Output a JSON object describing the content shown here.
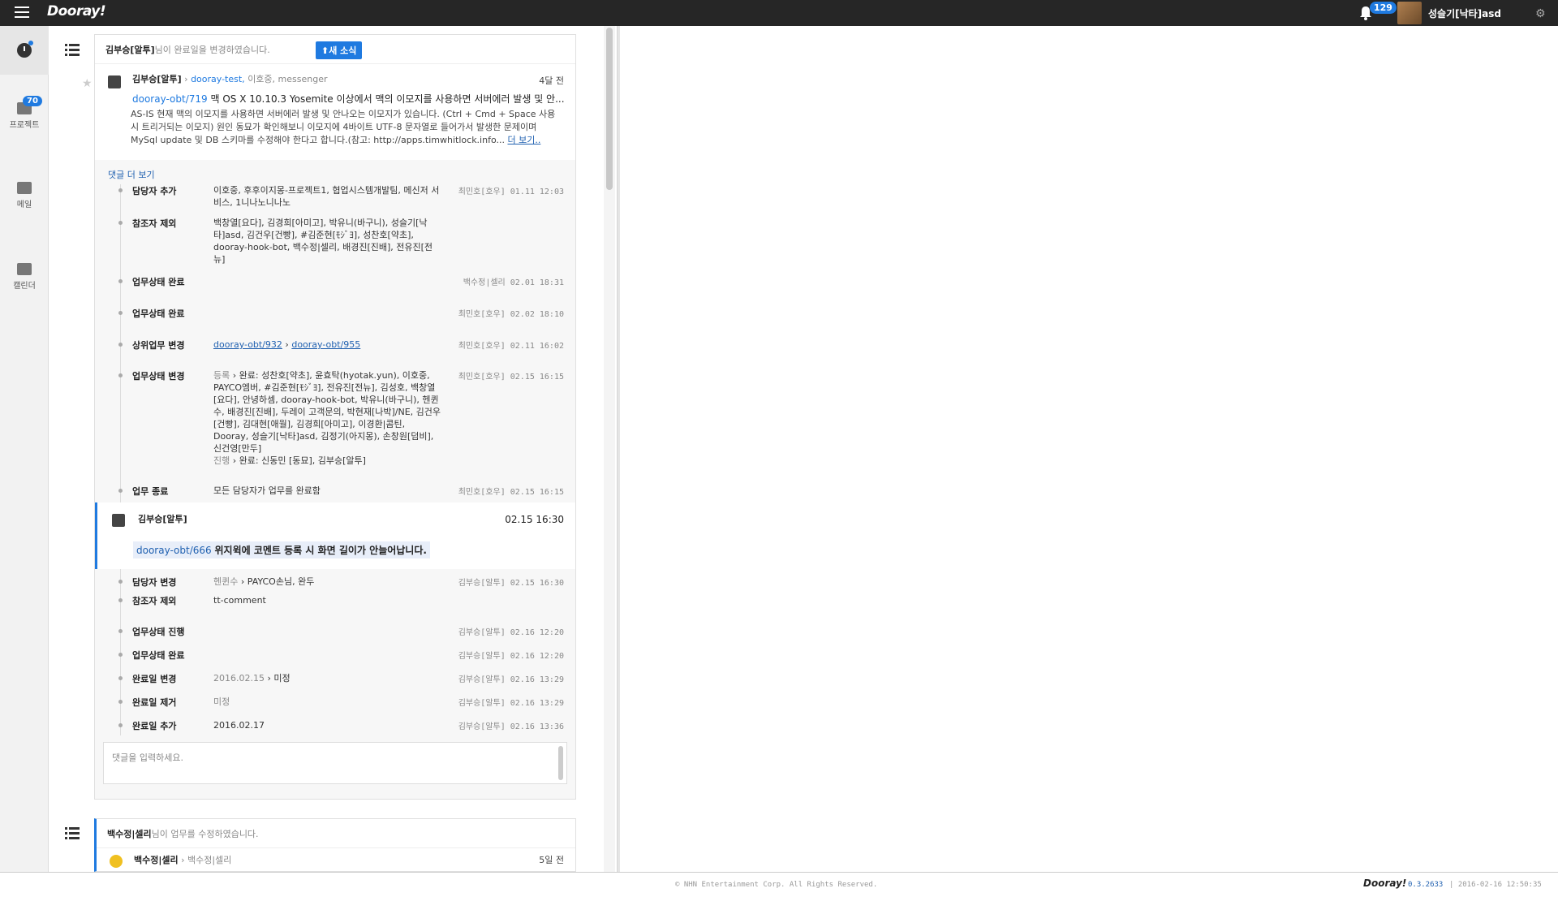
{
  "topbar": {
    "logo": "Dooray!",
    "notification_count": "129",
    "user_name": "성슬기[낙타]asd"
  },
  "lnb": [
    {
      "label": "프로젝트",
      "badge": "70"
    },
    {
      "label": "메일"
    },
    {
      "label": "캘린더"
    }
  ],
  "card1": {
    "header_user": "김부승[알투]",
    "header_text": "님이 완료일을 변경하였습니다.",
    "new_button": "새 소식",
    "post": {
      "author": "김부승[알투]",
      "project": "dooray-test,",
      "members": "이호중, messenger",
      "ago": "4달 전",
      "task_id": "dooray-obt/719",
      "task_title": "맥 OS X 10.10.3 Yosemite 이상에서 맥의 이모지를 사용하면 서버에러 발생 및 안...",
      "body": "AS-IS 현재 맥의 이모지를 사용하면 서버에러 발생 및 안나오는 이모지가 있습니다. (Ctrl + Cmd + Space 사용 시 트리거되는 이모지) 원인 동묘가 확인해보니 이모지에 4바이트 UTF-8 문자열로 들어가서 발생한 문제이며 MySql update 및 DB 스키마를 수정해야 한다고 합니다.(참고: http://apps.timwhitlock.info...",
      "more": "더 보기.."
    },
    "more_comments": "댓글 더 보기",
    "events": [
      {
        "label": "담당자 추가",
        "content": "이호중, 후후이지몽-프로젝트1, 협업시스템개발팀, 메신저 서비스, 1니나노니나노",
        "meta": "최민호[호우] 01.11 12:03"
      },
      {
        "label": "참조자 제외",
        "content": "백창열[요다], 김경희[아미고], 박유니(바구니), 성슬기[낙타]asd, 김건우[건빵], #김준현[ﾓｼﾞﾖ], 성찬호[약초], dooray-hook-bot, 백수정|셀리, 배경진[진배], 전유진[전뉴]",
        "meta": ""
      },
      {
        "label": "업무상태 완료",
        "content": "",
        "meta": "백수정|셀리 02.01 18:31"
      },
      {
        "label": "업무상태 완료",
        "content": "",
        "meta": "최민호[호우] 02.02 18:10"
      },
      {
        "label": "상위업무 변경",
        "link1": "dooray-obt/932",
        "link2": "dooray-obt/955",
        "meta": "최민호[호우] 02.11 16:02"
      },
      {
        "label": "업무상태 변경",
        "from1": "등록",
        "to1": "완료: 성찬호[약초], 윤효탁(hyotak.yun), 이호중, PAYCO엠버, #김준현[ﾓｼﾞﾖ], 전유진[전뉴], 김성호, 백창열[요다], 안녕하셈, dooray-hook-bot, 박유니(바구니), 헨퀸수, 배경진[진배], 두레이 고객문의, 박현재[나박]/NE, 김건우[건빵], 김대현[애월], 김경희[아미고], 이경환|콤틴, Dooray, 성슬기[낙타]asd, 김정기(아지몽), 손창원[덤비], 신건영[만두]",
        "from2": "진행",
        "to2": "완료: 신동민 [동묘], 김부승[알투]",
        "meta": "최민호[호우] 02.15 16:15"
      },
      {
        "label": "업무 종료",
        "content": "모든 담당자가 업무를 완료함",
        "meta": "최민호[호우] 02.15 16:15"
      }
    ],
    "comment": {
      "author": "김부승[알투]",
      "time": "02.15 16:30",
      "task_id": "dooray-obt/666",
      "text": "위지윅에 코멘트 등록 시 화면 길이가 안늘어납니다."
    },
    "events2": [
      {
        "label": "담당자 변경",
        "from": "헨퀸수",
        "to": "PAYCO손님, 완두",
        "meta": "김부승[알투] 02.15 16:30"
      },
      {
        "label": "참조자 제외",
        "content": "tt-comment",
        "meta": ""
      },
      {
        "label": "업무상태 진행",
        "content": "",
        "meta": "김부승[알투] 02.16 12:20"
      },
      {
        "label": "업무상태 완료",
        "content": "",
        "meta": "김부승[알투] 02.16 12:20"
      },
      {
        "label": "완료일 변경",
        "from": "2016.02.15",
        "to": "미정",
        "meta": "김부승[알투] 02.16 13:29"
      },
      {
        "label": "완료일 제거",
        "content_gray": "미정",
        "meta": "김부승[알투] 02.16 13:29"
      },
      {
        "label": "완료일 추가",
        "content": "2016.02.17",
        "meta": "김부승[알투] 02.16 13:36"
      }
    ],
    "comment_placeholder": "댓글을 입력하세요."
  },
  "card2": {
    "header_user": "백수정|셀리",
    "header_text": "님이 업무를 수정하였습니다.",
    "author": "백수정|셀리",
    "target": "백수정|셀리",
    "ago": "5일 전"
  },
  "footer": {
    "copyright": "© NHN Entertainment Corp. All Rights Reserved.",
    "logo": "Dooray!",
    "version": "0.3.2633",
    "timestamp": "| 2016-02-16 12:50:35"
  }
}
